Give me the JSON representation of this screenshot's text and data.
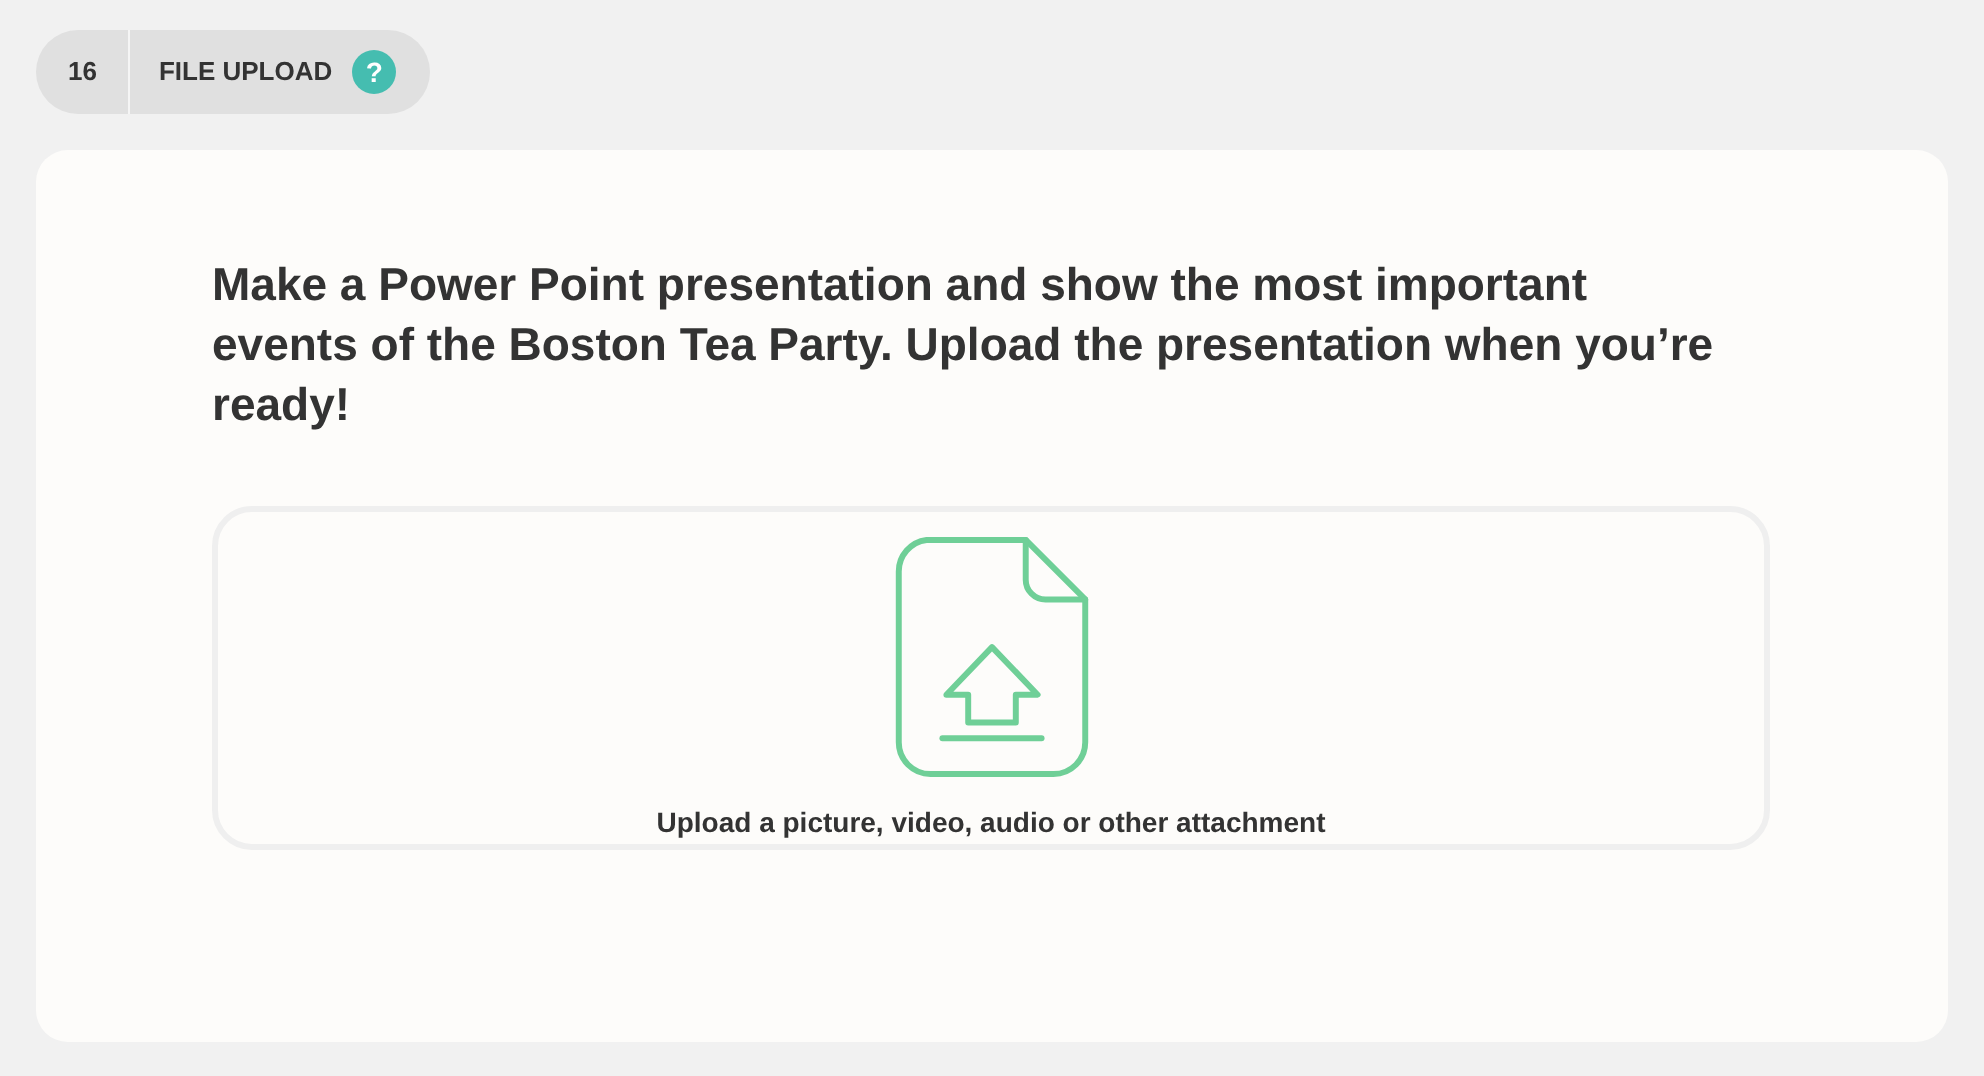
{
  "header": {
    "number": "16",
    "title": "FILE UPLOAD",
    "help": "?"
  },
  "question": "Make a Power Point presentation and show the most important events of the Boston Tea Party. Upload the presentation when you’re ready!",
  "dropzone": {
    "label": "Upload a picture, video, audio or other attachment"
  }
}
